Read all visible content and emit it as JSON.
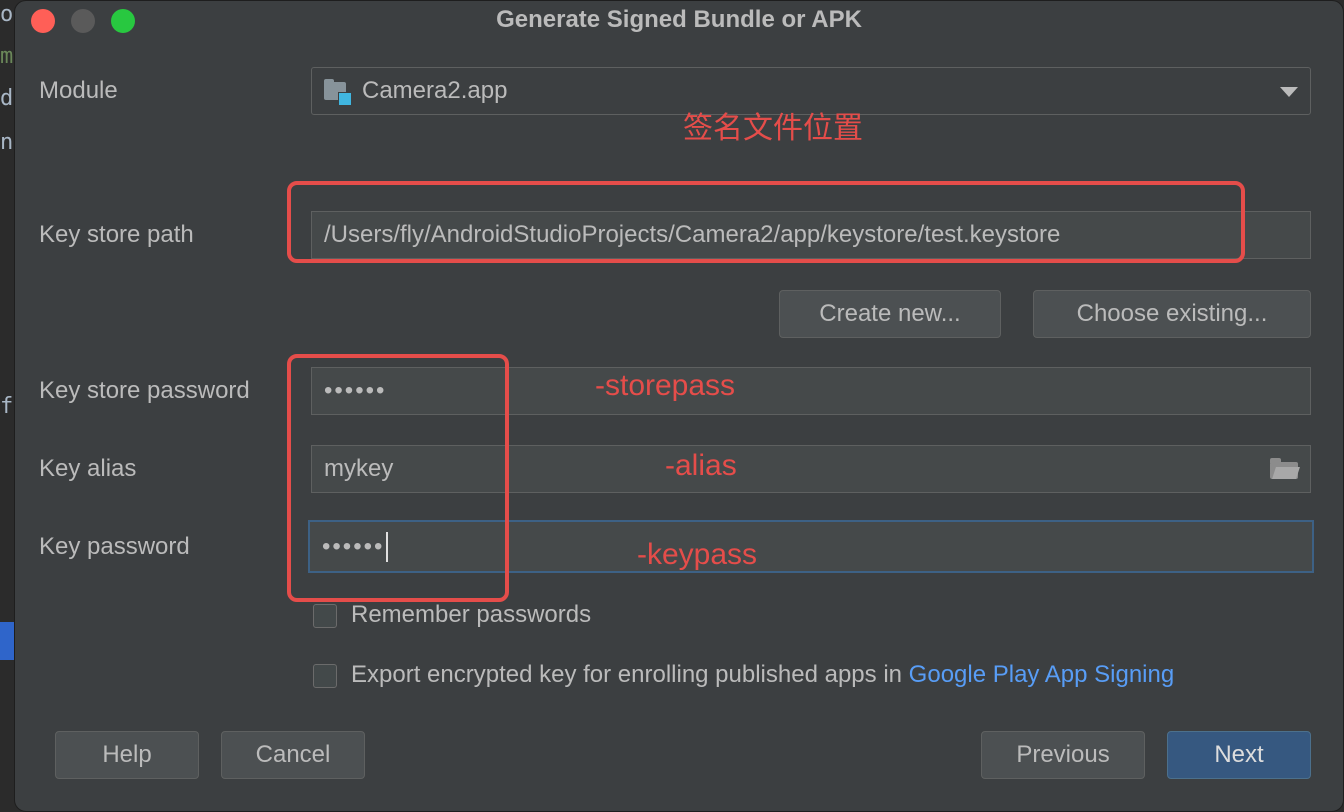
{
  "dialog": {
    "title": "Generate Signed Bundle or APK"
  },
  "background_editor": {
    "glyphs": [
      "o",
      "m",
      "d",
      "n",
      "f"
    ]
  },
  "form": {
    "module_label": "Module",
    "module_value": "Camera2.app",
    "keystore_path_label": "Key store path",
    "keystore_path_value": "/Users/fly/AndroidStudioProjects/Camera2/app/keystore/test.keystore",
    "create_new_label": "Create new...",
    "choose_existing_label": "Choose existing...",
    "keystore_password_label": "Key store password",
    "keystore_password_value": "••••••",
    "key_alias_label": "Key alias",
    "key_alias_value": "mykey",
    "key_password_label": "Key password",
    "key_password_value": "••••••",
    "remember_passwords_label": "Remember passwords",
    "remember_passwords_checked": false,
    "export_key_label": "Export encrypted key for enrolling published apps in",
    "export_key_link": "Google Play App Signing",
    "export_key_checked": false
  },
  "footer": {
    "help_label": "Help",
    "cancel_label": "Cancel",
    "previous_label": "Previous",
    "next_label": "Next"
  },
  "annotations": {
    "signature_location": "签名文件位置",
    "storepass": "-storepass",
    "alias": "-alias",
    "keypass": "-keypass",
    "color": "#e54d4a"
  },
  "colors": {
    "dialog_bg": "#3c3f41",
    "field_bg": "#45494a",
    "text": "#bbbbbb",
    "primary_button": "#365880",
    "link": "#589df6",
    "focus_border": "#3d6185"
  },
  "icons": {
    "module": "module-folder-icon",
    "dropdown": "chevron-down-icon",
    "browse": "folder-open-icon"
  }
}
